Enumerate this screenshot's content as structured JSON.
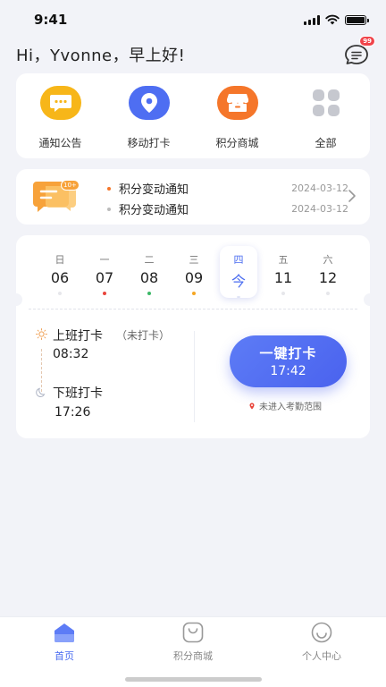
{
  "status": {
    "time": "9:41"
  },
  "greeting": "Hi，Yvonne，早上好!",
  "messages": {
    "badge": "99",
    "icon": "chat-icon"
  },
  "shortcuts": [
    {
      "label": "通知公告",
      "icon": "announcement-icon",
      "color": "#f7b619"
    },
    {
      "label": "移动打卡",
      "icon": "location-pin-icon",
      "color": "#4e6ef2"
    },
    {
      "label": "积分商城",
      "icon": "store-icon",
      "color": "#f5762a"
    },
    {
      "label": "全部",
      "icon": "grid-icon",
      "color": "#c6c8cf"
    }
  ],
  "notice": {
    "badge": "10+",
    "items": [
      {
        "title": "积分变动通知",
        "date": "2024-03-12",
        "dot_color": "#f5762a"
      },
      {
        "title": "积分变动通知",
        "date": "2024-03-12",
        "dot_color": "#bbbbbb"
      }
    ]
  },
  "week": [
    {
      "name": "日",
      "num": "06",
      "dot": ""
    },
    {
      "name": "一",
      "num": "07",
      "dot": "#e8453c"
    },
    {
      "name": "二",
      "num": "08",
      "dot": "#3cb867"
    },
    {
      "name": "三",
      "num": "09",
      "dot": "#f5a623"
    },
    {
      "name": "四",
      "num": "今",
      "dot": "",
      "today": true
    },
    {
      "name": "五",
      "num": "11",
      "dot": ""
    },
    {
      "name": "六",
      "num": "12",
      "dot": ""
    }
  ],
  "clock_in": {
    "label": "上班打卡",
    "status": "（未打卡）",
    "time": "08:32"
  },
  "clock_out": {
    "label": "下班打卡",
    "time": "17:26"
  },
  "punch_button": {
    "title": "一键打卡",
    "time": "17:42"
  },
  "range_hint": "未进入考勤范围",
  "tabs": [
    {
      "label": "首页",
      "icon": "home-icon",
      "active": true
    },
    {
      "label": "积分商城",
      "icon": "shopping-bag-icon",
      "active": false
    },
    {
      "label": "个人中心",
      "icon": "smiley-icon",
      "active": false
    }
  ],
  "colors": {
    "accent": "#4a6cf0",
    "background": "#f2f3f8"
  }
}
